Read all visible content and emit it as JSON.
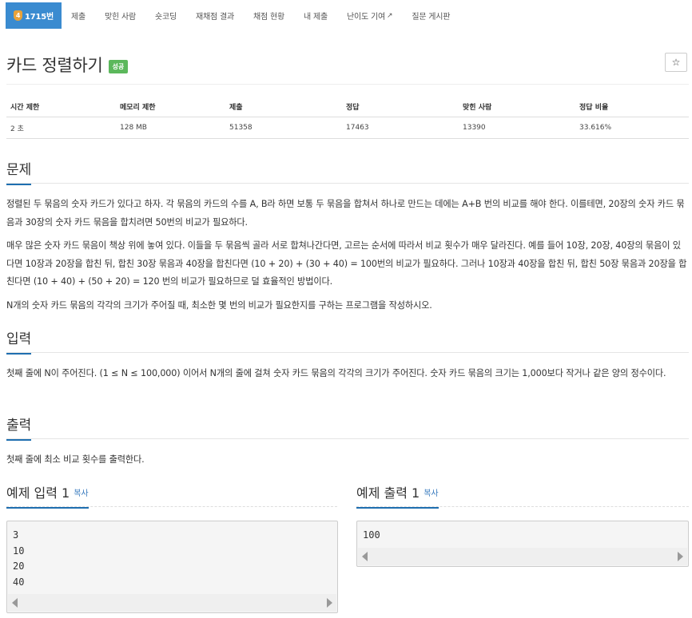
{
  "nav": {
    "problem_number": "1715번",
    "tier_label": "4",
    "tabs": [
      "제출",
      "맞힌 사람",
      "숏코딩",
      "재채점 결과",
      "채점 현황",
      "내 제출",
      "난이도 기여",
      "질문 게시판"
    ]
  },
  "problem": {
    "title": "카드 정렬하기",
    "status_badge": "성공",
    "star": "☆"
  },
  "info_table": {
    "headers": [
      "시간 제한",
      "메모리 제한",
      "제출",
      "정답",
      "맞힌 사람",
      "정답 비율"
    ],
    "values": [
      "2 초",
      "128 MB",
      "51358",
      "17463",
      "13390",
      "33.616%"
    ]
  },
  "sections": {
    "description_heading": "문제",
    "description_paragraphs": [
      "정렬된 두 묶음의 숫자 카드가 있다고 하자. 각 묶음의 카드의 수를 A, B라 하면 보통 두 묶음을 합쳐서 하나로 만드는 데에는 A+B 번의 비교를 해야 한다. 이를테면, 20장의 숫자 카드 묶음과 30장의 숫자 카드 묶음을 합치려면 50번의 비교가 필요하다.",
      "매우 많은 숫자 카드 묶음이 책상 위에 놓여 있다. 이들을 두 묶음씩 골라 서로 합쳐나간다면, 고르는 순서에 따라서 비교 횟수가 매우 달라진다. 예를 들어 10장, 20장, 40장의 묶음이 있다면 10장과 20장을 합친 뒤, 합친 30장 묶음과 40장을 합친다면 (10 + 20) + (30 + 40) = 100번의 비교가 필요하다. 그러나 10장과 40장을 합친 뒤, 합친 50장 묶음과 20장을 합친다면 (10 + 40) + (50 + 20) = 120 번의 비교가 필요하므로 덜 효율적인 방법이다.",
      "N개의 숫자 카드 묶음의 각각의 크기가 주어질 때, 최소한 몇 번의 비교가 필요한지를 구하는 프로그램을 작성하시오."
    ],
    "input_heading": "입력",
    "input_text": "첫째 줄에 N이 주어진다. (1 ≤ N ≤ 100,000) 이어서 N개의 줄에 걸쳐 숫자 카드 묶음의 각각의 크기가 주어진다. 숫자 카드 묶음의 크기는 1,000보다 작거나 같은 양의 정수이다.",
    "output_heading": "출력",
    "output_text": "첫째 줄에 최소 비교 횟수를 출력한다."
  },
  "examples": {
    "input_title": "예제 입력 1",
    "output_title": "예제 출력 1",
    "copy_label": "복사",
    "input_content": "3\n10\n20\n40",
    "output_content": "100"
  },
  "colors": {
    "active_tab": "#3a8bd0",
    "success_badge": "#5cb85c",
    "section_underline": "#1f6fb0",
    "copy_link": "#3a7bbf"
  }
}
